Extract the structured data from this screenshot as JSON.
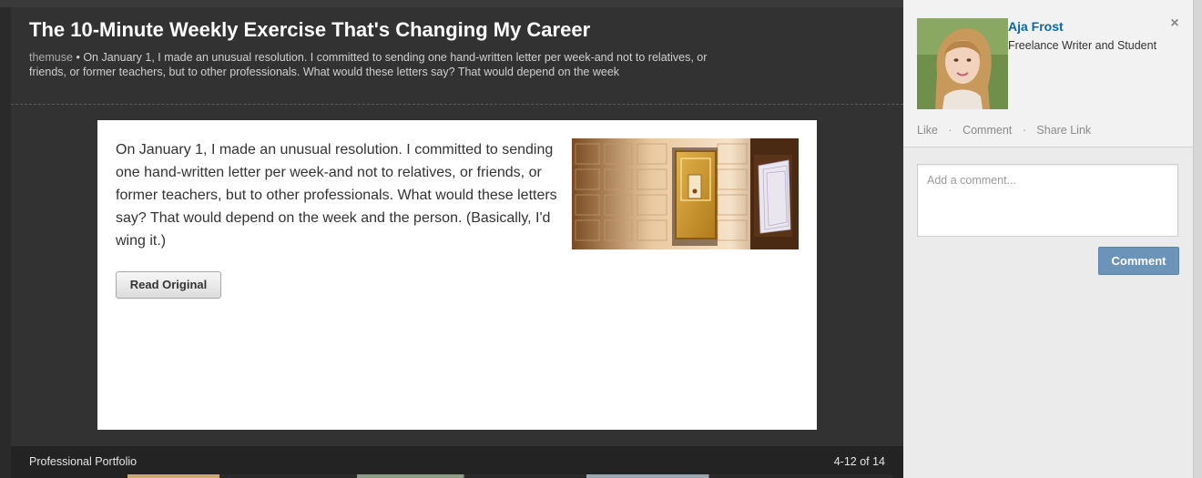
{
  "article": {
    "title": "The 10-Minute Weekly Exercise That's Changing My Career",
    "source": "themuse",
    "separator": "•",
    "summary": "On January 1, I made an unusual resolution. I committed to sending one hand-written letter per week-and not to relatives, or friends, or former teachers, but to other professionals. What would these letters say? That would depend on the week",
    "body": "On January 1, I made an unusual resolution. I committed to sending one hand-written letter per week-and not to relatives, or friends, or former teachers, but to other professionals. What would these letters say? That would depend on the week and the person. (Basically, I'd wing it.)",
    "image_icon": "mailboxes-image",
    "read_original_label": "Read Original"
  },
  "footer": {
    "section_label": "Professional Portfolio",
    "pagination": "4-12 of 14"
  },
  "sidebar": {
    "author_name": "Aja Frost",
    "author_headline": "Freelance Writer and Student",
    "close_label": "×",
    "actions": {
      "like": "Like",
      "comment": "Comment",
      "share": "Share Link",
      "dot": "·"
    },
    "comment_placeholder": "Add a comment...",
    "comment_button": "Comment"
  },
  "colors": {
    "accent_link": "#0a6aa6",
    "comment_button": "#6c93b8",
    "dark_bg": "#323232"
  }
}
